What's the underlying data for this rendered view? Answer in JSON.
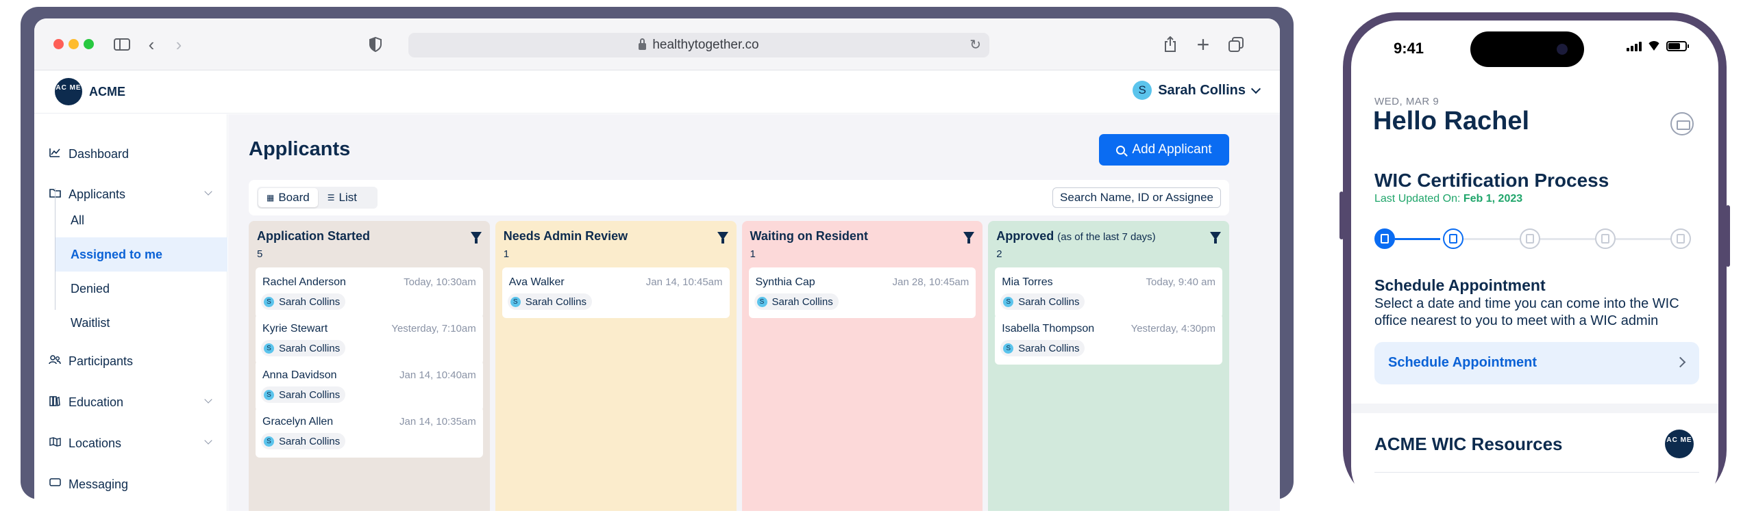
{
  "browser": {
    "url": "healthytogether.co"
  },
  "app": {
    "logo_text": "AC ME",
    "name": "ACME",
    "user_initial": "S",
    "user_name": "Sarah Collins"
  },
  "sidebar": {
    "items": [
      {
        "label": "Dashboard",
        "icon": "chart-icon"
      },
      {
        "label": "Applicants",
        "icon": "folder-icon"
      },
      {
        "label": "Participants",
        "icon": "users-icon"
      },
      {
        "label": "Education",
        "icon": "books-icon"
      },
      {
        "label": "Locations",
        "icon": "map-icon"
      },
      {
        "label": "Messaging",
        "icon": "message-icon"
      }
    ],
    "applicant_sub": [
      "All",
      "Assigned to me",
      "Denied",
      "Waitlist"
    ]
  },
  "main": {
    "title": "Applicants",
    "add_button": "Add Applicant",
    "view_board": "Board",
    "view_list": "List",
    "search_placeholder": "Search Name, ID or Assignee"
  },
  "board": {
    "columns": [
      {
        "title": "Application Started",
        "note": "",
        "count": "5",
        "color": "#ebe4df",
        "cards": [
          {
            "name": "Rachel Anderson",
            "time": "Today, 10:30am",
            "assignee": "Sarah Collins"
          },
          {
            "name": "Kyrie Stewart",
            "time": "Yesterday, 7:10am",
            "assignee": "Sarah Collins"
          },
          {
            "name": "Anna Davidson",
            "time": "Jan 14, 10:40am",
            "assignee": "Sarah Collins"
          },
          {
            "name": "Gracelyn Allen",
            "time": "Jan 14, 10:35am",
            "assignee": "Sarah Collins"
          }
        ]
      },
      {
        "title": "Needs Admin Review",
        "note": "",
        "count": "1",
        "color": "#fbeccc",
        "cards": [
          {
            "name": "Ava Walker",
            "time": "Jan 14, 10:45am",
            "assignee": "Sarah Collins"
          }
        ]
      },
      {
        "title": "Waiting on Resident",
        "note": "",
        "count": "1",
        "color": "#fcd9d9",
        "cards": [
          {
            "name": "Synthia Cap",
            "time": "Jan 28, 10:45am",
            "assignee": "Sarah Collins"
          }
        ]
      },
      {
        "title": "Approved",
        "note": "(as of the last 7 days)",
        "count": "2",
        "color": "#d2e9dc",
        "cards": [
          {
            "name": "Mia Torres",
            "time": "Today, 9:40 am",
            "assignee": "Sarah Collins"
          },
          {
            "name": "Isabella Thompson",
            "time": "Yesterday, 4:30pm",
            "assignee": "Sarah Collins"
          }
        ]
      }
    ]
  },
  "phone": {
    "time": "9:41",
    "date": "WED, MAR 9",
    "greeting": "Hello Rachel",
    "process_title": "WIC Certification Process",
    "updated_label": "Last Updated On:",
    "updated_date": "Feb 1, 2023",
    "step_title": "Schedule Appointment",
    "step_desc": "Select a date and time you can come into the WIC office nearest to you to meet with a WIC admin",
    "step_button": "Schedule Appointment",
    "resources_title": "ACME WIC Resources",
    "logo_text": "AC ME"
  }
}
